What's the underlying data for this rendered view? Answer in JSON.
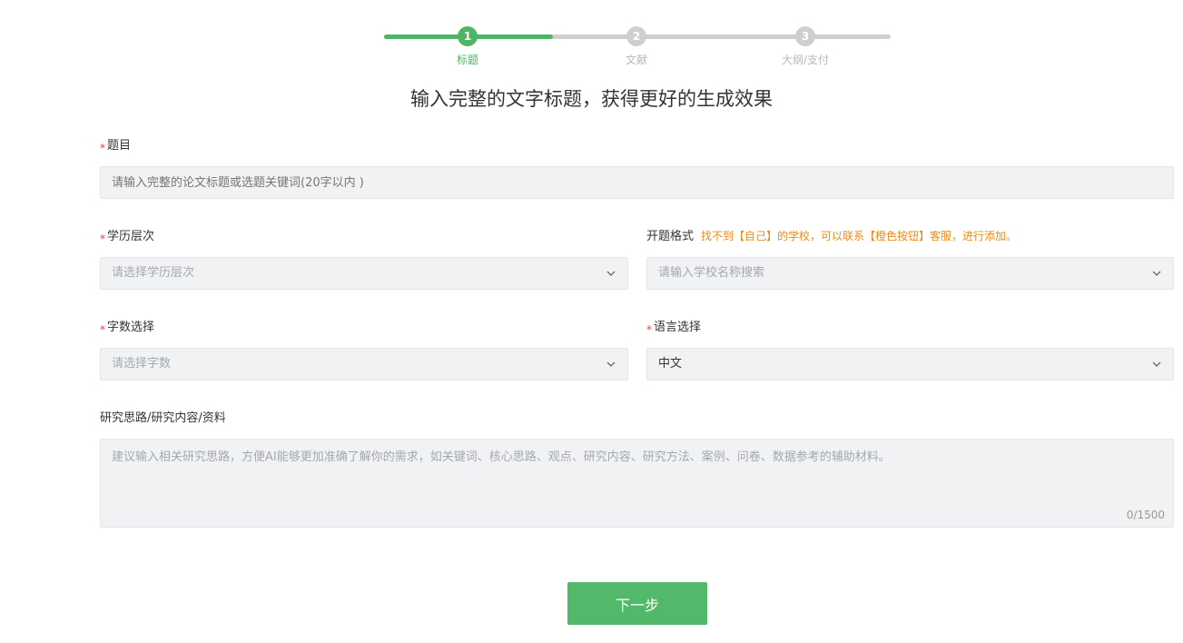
{
  "stepper": {
    "steps": [
      {
        "number": "1",
        "label": "标题"
      },
      {
        "number": "2",
        "label": "文献"
      },
      {
        "number": "3",
        "label": "大纲/支付"
      }
    ],
    "active_step": 1
  },
  "headline": "输入完整的文字标题，获得更好的生成效果",
  "form": {
    "required_mark": "*",
    "title": {
      "label": "题目",
      "placeholder": "请输入完整的论文标题或选题关键词(20字以内 )"
    },
    "education": {
      "label": "学历层次",
      "placeholder": "请选择学历层次"
    },
    "proposal_format": {
      "label": "开题格式",
      "note": "找不到【自己】的学校，可以联系【橙色按钮】客服，进行添加。",
      "placeholder": "请输入学校名称搜索"
    },
    "word_count": {
      "label": "字数选择",
      "placeholder": "请选择字数"
    },
    "language": {
      "label": "语言选择",
      "value": "中文"
    },
    "research": {
      "label": "研究思路/研究内容/资料",
      "placeholder": "建议输入相关研究思路，方便AI能够更加准确了解你的需求，如关键词、核心思路、观点、研究内容、研究方法、案例、问卷、数据参考的辅助材料。",
      "counter": "0/1500"
    }
  },
  "next_button": "下一步",
  "colors": {
    "accent": "#4cb664",
    "required": "#e83a3a",
    "note": "#f08a17",
    "field_bg": "#f1f2f4"
  }
}
